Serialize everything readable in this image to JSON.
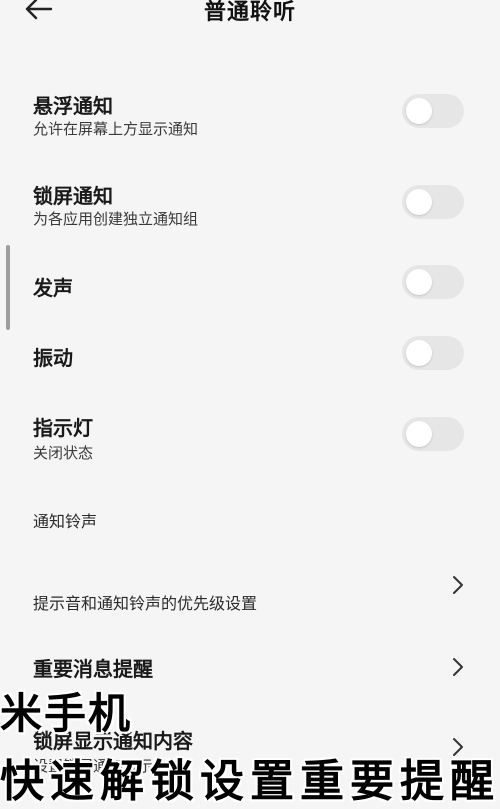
{
  "header": {
    "title": "普通聆听"
  },
  "settings": [
    {
      "title": "悬浮通知",
      "subtitle": "允许在屏幕上方显示通知",
      "control": "toggle",
      "on": false
    },
    {
      "title": "锁屏通知",
      "subtitle": "为各应用创建独立通知组",
      "control": "toggle",
      "on": false
    },
    {
      "title": "发声",
      "control": "toggle",
      "on": false
    },
    {
      "title": "振动",
      "control": "toggle",
      "on": false
    },
    {
      "title": "指示灯",
      "subtitle": "关闭状态",
      "control": "toggle",
      "on": false
    },
    {
      "title": "通知铃声"
    },
    {
      "subtitle": "提示音和通知铃声的优先级设置",
      "control": "chevron"
    },
    {
      "title": "重要消息提醒",
      "control": "chevron"
    },
    {
      "title": "锁屏显示通知内容",
      "subtitle": "设置锁屏通知显示",
      "control": "chevron"
    }
  ],
  "overlay": {
    "line1": "米手机",
    "line2": "快速解锁设置重要提醒"
  },
  "colors": {
    "background": "#f5f5f5",
    "toggle_off": "#e6e6e6",
    "text": "#1a1a1a"
  },
  "icons": {
    "back": "arrow-left-icon",
    "chevron": "chevron-right-icon"
  }
}
